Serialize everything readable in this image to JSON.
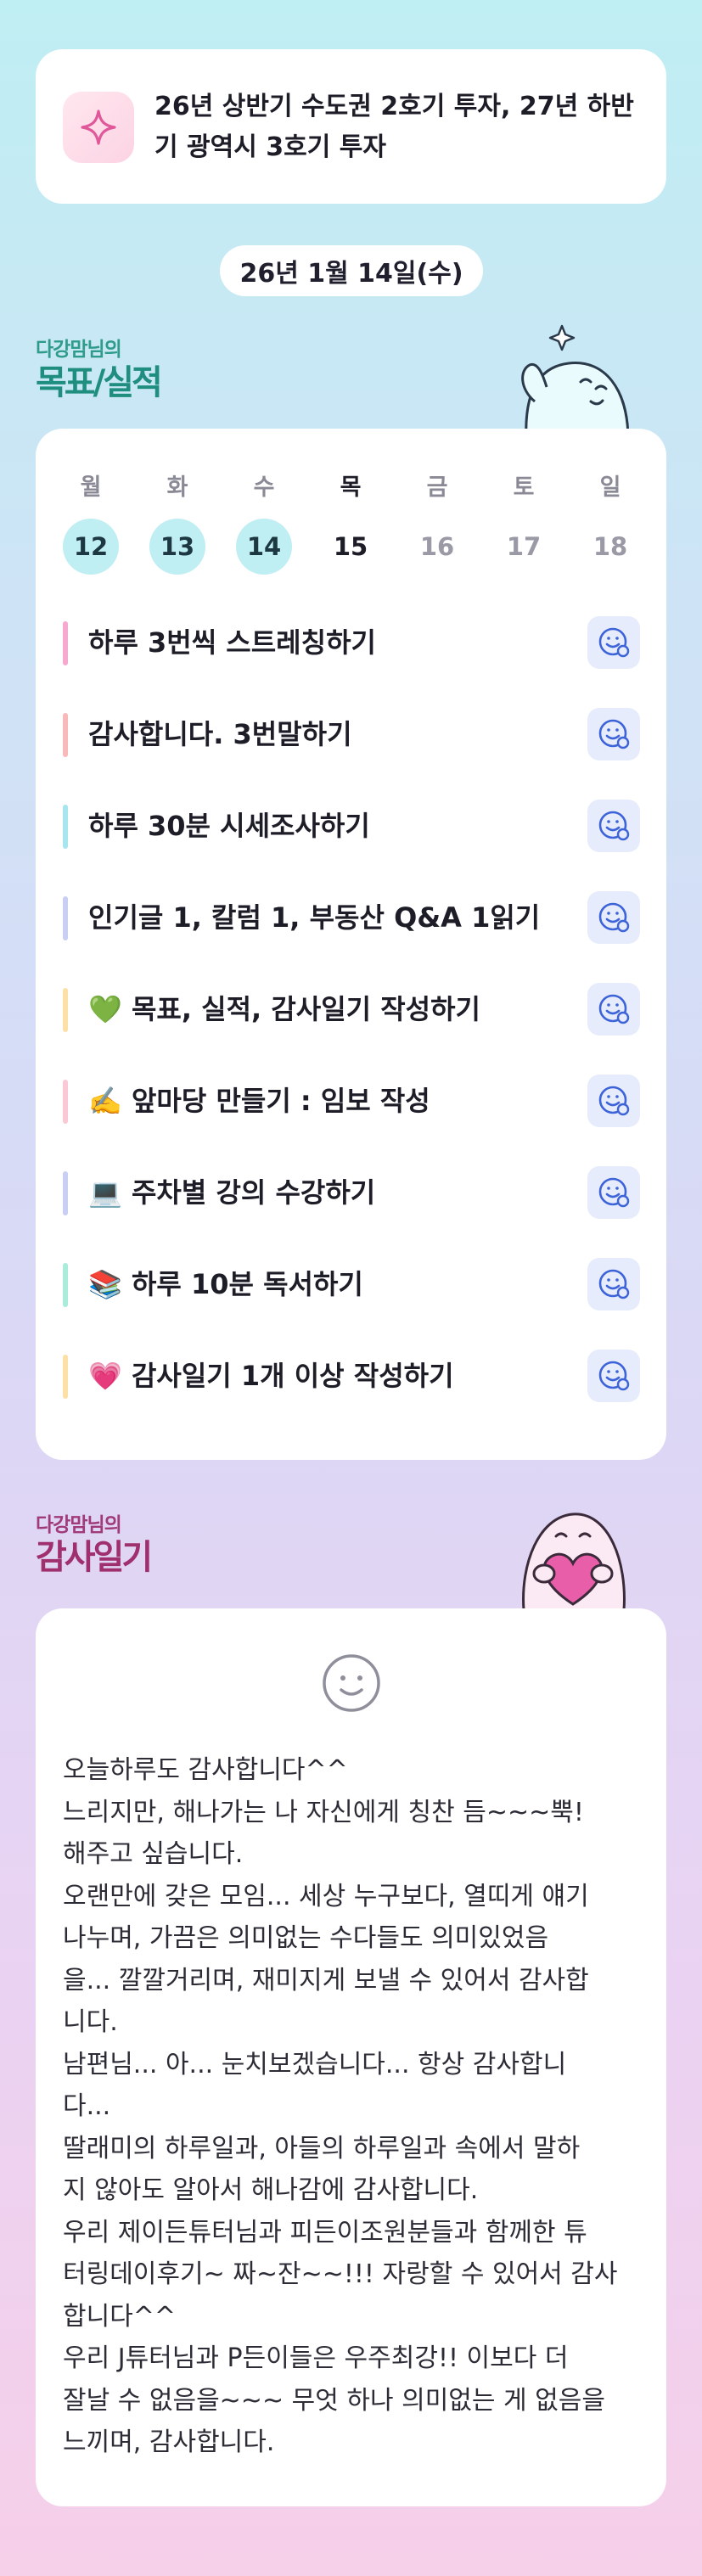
{
  "goal": {
    "text": "26년 상반기 수도권 2호기 투자, 27년 하반기 광역시 3호기 투자",
    "icon": "sparkle-icon"
  },
  "date_label": "26년 1월 14일(수)",
  "goals_section": {
    "small": "다강맘님의",
    "big": "목표/실적"
  },
  "week": [
    {
      "day": "월",
      "date": "12"
    },
    {
      "day": "화",
      "date": "13"
    },
    {
      "day": "수",
      "date": "14"
    },
    {
      "day": "목",
      "date": "15"
    },
    {
      "day": "금",
      "date": "16"
    },
    {
      "day": "토",
      "date": "17"
    },
    {
      "day": "일",
      "date": "18"
    }
  ],
  "goals": [
    {
      "label": "하루 3번씩 스트레칭하기",
      "color": "#f7a8cf"
    },
    {
      "label": "감사합니다. 3번말하기",
      "color": "#f9b9b9"
    },
    {
      "label": "하루 30분 시세조사하기",
      "color": "#a8e6ef"
    },
    {
      "label": "인기글 1, 칼럼 1, 부동산 Q&A 1읽기",
      "color": "#c9cff4"
    },
    {
      "label": "💚 목표, 실적, 감사일기 작성하기",
      "color": "#fde0a6"
    },
    {
      "label": "✍️ 앞마당 만들기 : 임보 작성",
      "color": "#fbc9d6"
    },
    {
      "label": "💻 주차별 강의 수강하기",
      "color": "#c9cff4"
    },
    {
      "label": "📚 하루 10분 독서하기",
      "color": "#a8ecd9"
    },
    {
      "label": "💗 감사일기 1개 이상 작성하기",
      "color": "#fde0a6"
    }
  ],
  "diary_section": {
    "small": "다강맘님의",
    "big": "감사일기"
  },
  "diary": {
    "lines": [
      "오늘하루도 감사합니다^^",
      "느리지만, 해나가는 나 자신에게 칭찬 듬~~~뿍!",
      "해주고 싶습니다.",
      "오랜만에 갖은 모임... 세상 누구보다, 열띠게 얘기",
      "나누며, 가끔은 의미없는 수다들도 의미있었음",
      "을... 깔깔거리며, 재미지게 보낼 수 있어서 감사합",
      "니다.",
      "남편님... 아... 눈치보겠습니다... 항상 감사합니",
      "다...",
      "딸래미의 하루일과, 아들의 하루일과 속에서 말하",
      "지 않아도 알아서 해나감에 감사합니다.",
      "우리 제이든튜터님과 피든이조원분들과 함께한 튜",
      "터링데이후기~ 짜~잔~~!!! 자랑할 수 있어서 감사",
      "합니다^^",
      "우리 J튜터님과 P든이들은 우주최강!! 이보다 더",
      "잘날 수 없음을~~~ 무엇 하나 의미없는 게 없음을",
      "느끼며, 감사합니다."
    ]
  }
}
